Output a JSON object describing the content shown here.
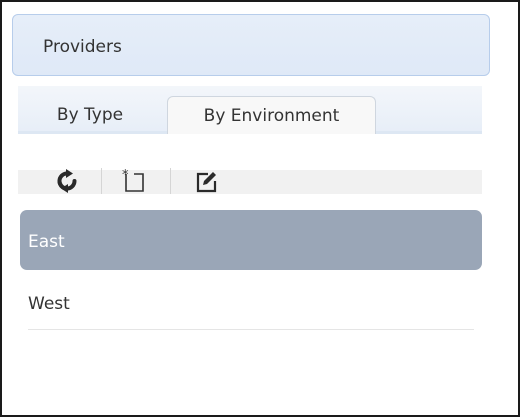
{
  "header": {
    "title": "Providers"
  },
  "tabs": [
    {
      "label": "By Type",
      "active": false
    },
    {
      "label": "By Environment",
      "active": true
    }
  ],
  "toolbar": {
    "buttons": [
      {
        "icon": "refresh-icon"
      },
      {
        "icon": "new-icon"
      },
      {
        "icon": "edit-icon"
      }
    ]
  },
  "list": {
    "items": [
      {
        "label": "East",
        "selected": true
      },
      {
        "label": "West",
        "selected": false
      }
    ]
  },
  "colors": {
    "header_bg": "#e6eef9",
    "header_border": "#b7cdeb",
    "selected_bg": "#9aa6b7",
    "text": "#333333"
  }
}
